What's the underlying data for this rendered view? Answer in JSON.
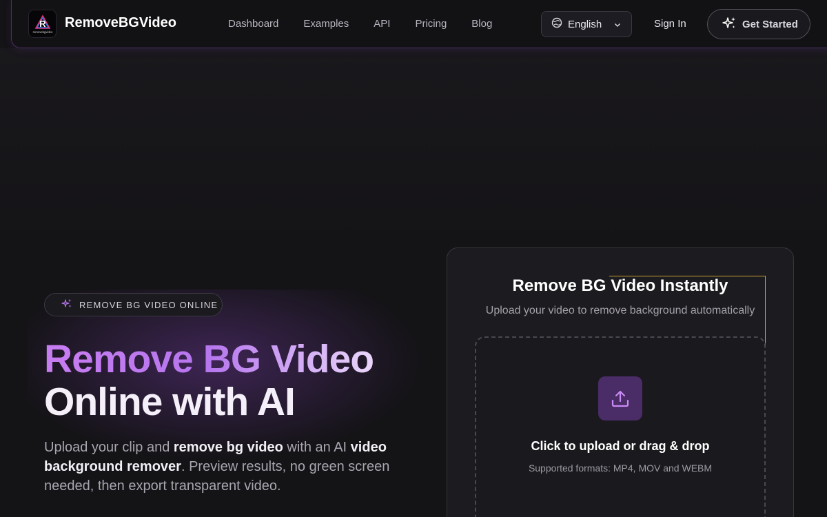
{
  "header": {
    "brand": "RemoveBGVideo",
    "logo_text": "removebgvideo",
    "nav": [
      "Dashboard",
      "Examples",
      "API",
      "Pricing",
      "Blog"
    ],
    "language": "English",
    "sign_in": "Sign In",
    "cta": "Get Started"
  },
  "hero": {
    "badge": "REMOVE BG VIDEO ONLINE",
    "title_line1": "Remove BG Video",
    "title_line2": "Online with AI",
    "subtitle": {
      "t1": "Upload your clip and ",
      "b1": "remove bg video",
      "t2": " with an AI ",
      "b2": "video background remover",
      "t3": ". Preview results, no green screen needed, then export transparent video."
    }
  },
  "upload_card": {
    "title": "Remove BG Video Instantly",
    "subtitle": "Upload your video to remove background automatically",
    "drop_title": "Click to upload or drag & drop",
    "formats": "Supported formats: MP4, MOV and WEBM"
  },
  "colors": {
    "accent_purple": "#b676ee",
    "background": "#141316",
    "upload_icon_bg": "#4a2c66"
  },
  "icons": [
    "logo-icon",
    "globe-icon",
    "chevron-down-icon",
    "sparkles-icon",
    "upload-icon"
  ]
}
